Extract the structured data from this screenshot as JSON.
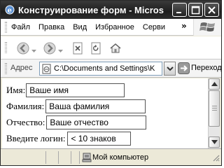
{
  "window": {
    "title": "Конструирование форм - Micros"
  },
  "menu": {
    "items": [
      {
        "label": "Файл"
      },
      {
        "label": "Правка"
      },
      {
        "label": "Вид"
      },
      {
        "label": "Избранное"
      },
      {
        "label": "Серви"
      }
    ],
    "overflow": "»"
  },
  "address": {
    "label": "Адрес",
    "value": "C:\\Documents and Settings\\K",
    "go_label": "Переход"
  },
  "form": {
    "rows": [
      {
        "label": "Имя:",
        "value": "Ваше имя"
      },
      {
        "label": "Фамилия:",
        "value": "Ваша фамилия"
      },
      {
        "label": "Отчество:",
        "value": "Ваше отчество"
      },
      {
        "label": "Введите логин:",
        "value": "< 10 знаков"
      }
    ]
  },
  "status": {
    "zone": "Мой компьютер"
  },
  "colors": {
    "titlebar": "#222222",
    "chrome": "#ece9d8",
    "field_border": "#555555"
  }
}
